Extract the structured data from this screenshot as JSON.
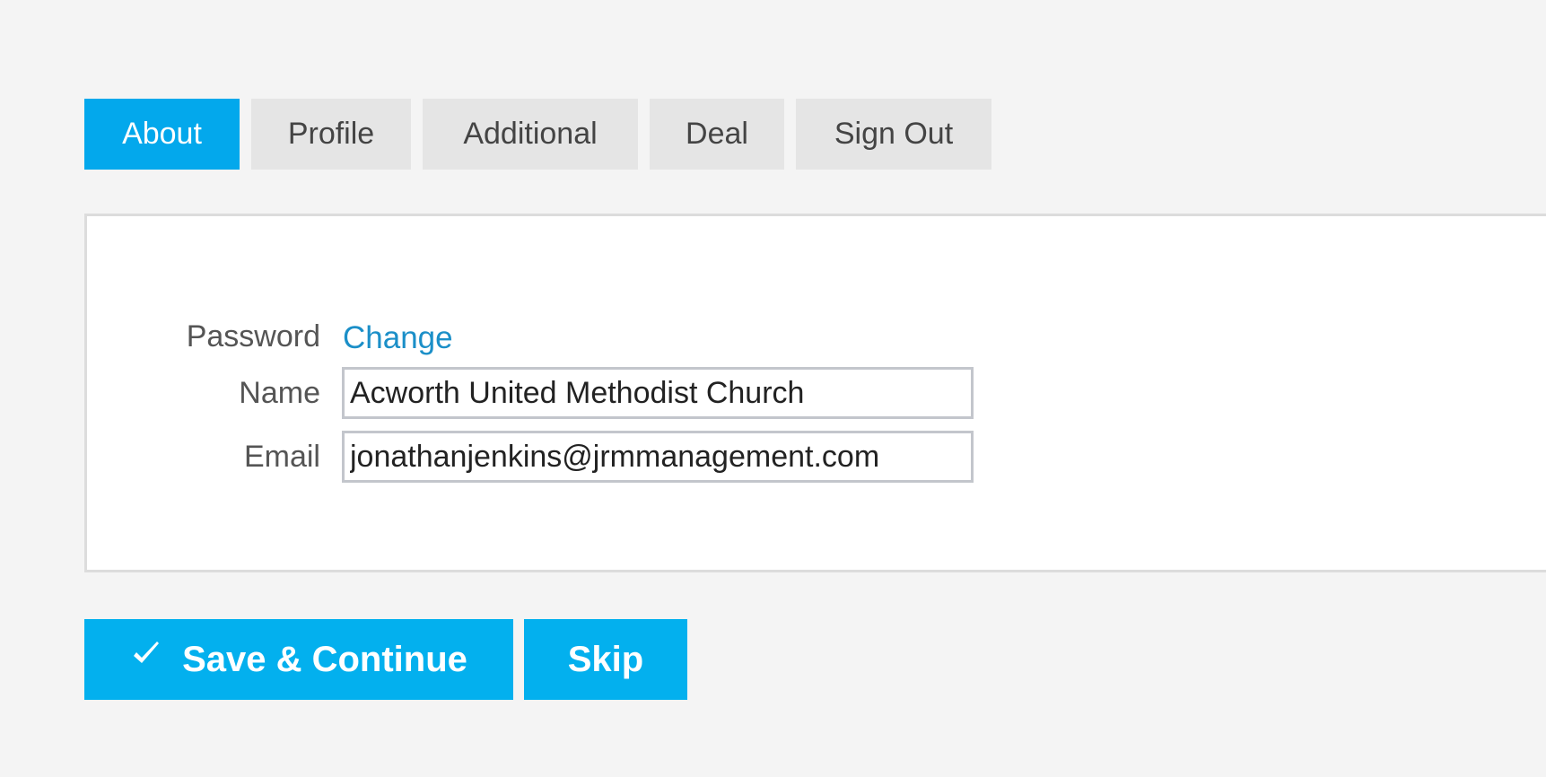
{
  "tabs": [
    {
      "label": "About",
      "active": true
    },
    {
      "label": "Profile",
      "active": false
    },
    {
      "label": "Additional",
      "active": false
    },
    {
      "label": "Deal",
      "active": false
    },
    {
      "label": "Sign Out",
      "active": false
    }
  ],
  "form": {
    "password": {
      "label": "Password",
      "link_text": "Change"
    },
    "name": {
      "label": "Name",
      "value": "Acworth United Methodist Church"
    },
    "email": {
      "label": "Email",
      "value": "jonathanjenkins@jrmmanagement.com"
    }
  },
  "actions": {
    "save_label": "Save & Continue",
    "save_icon": "checkmark-icon",
    "skip_label": "Skip"
  },
  "colors": {
    "accent": "#03a8ec",
    "button": "#03b0ee",
    "link": "#1b8fc8",
    "tab_inactive": "#e5e5e5",
    "background": "#f4f4f4"
  }
}
